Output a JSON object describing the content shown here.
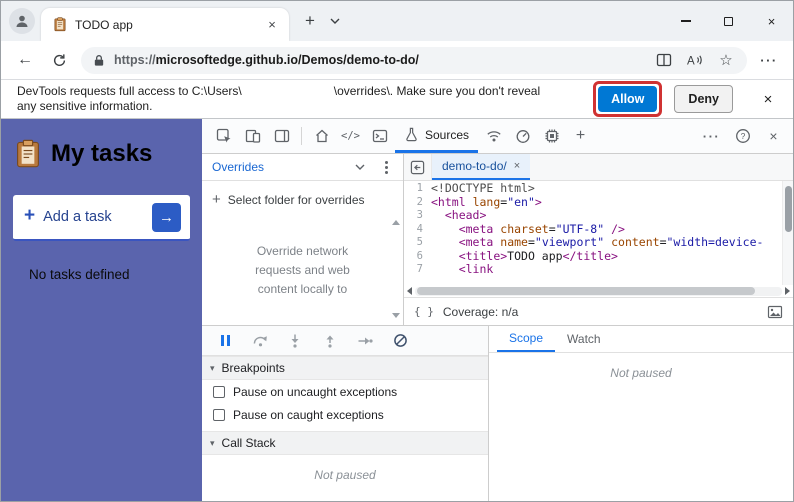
{
  "colors": {
    "app_bg": "#5a64ad",
    "accent": "#1a73e8",
    "allow_bg": "#0078d4",
    "annotation": "#d03232"
  },
  "icons": {
    "close": "×",
    "plus": "+",
    "back": "←",
    "star": "☆",
    "more": "···",
    "elements": "</>",
    "braces": "{ }",
    "arrow_right": "→",
    "disclosure": "▾"
  },
  "browser": {
    "tab_title": "TODO app",
    "url_scheme": "https://",
    "url_domain": "microsoftedge.github.io",
    "url_path": "/Demos/demo-to-do/"
  },
  "infobar": {
    "message_line1_before_redaction": "DevTools requests full access to C:\\Users\\",
    "message_line1_after_redaction": "\\overrides\\. Make sure you don't reveal",
    "message_line2": "any sensitive information.",
    "allow_label": "Allow",
    "deny_label": "Deny"
  },
  "app": {
    "title": "My tasks",
    "add_task_label": "Add a task",
    "empty_message": "No tasks defined"
  },
  "devtools": {
    "sources_tab_label": "Sources",
    "navigator": {
      "dropdown_label": "Overrides",
      "select_folder_label": "Select folder for overrides",
      "description_lines": [
        "Override network",
        "requests and web",
        "content locally to"
      ]
    },
    "editor": {
      "file_tab_label": "demo-to-do/",
      "coverage_label": "Coverage: n/a",
      "code_lines": [
        {
          "n": "1",
          "t": [
            [
              "meta",
              "<!DOCTYPE html>"
            ]
          ]
        },
        {
          "n": "2",
          "t": [
            [
              "tag",
              "<html"
            ],
            [
              "plain",
              " "
            ],
            [
              "attr",
              "lang"
            ],
            [
              "plain",
              "="
            ],
            [
              "str",
              "\"en\""
            ],
            [
              "tag",
              ">"
            ]
          ]
        },
        {
          "n": "3",
          "t": [
            [
              "plain",
              "  "
            ],
            [
              "tag",
              "<head>"
            ]
          ]
        },
        {
          "n": "4",
          "t": [
            [
              "plain",
              "    "
            ],
            [
              "tag",
              "<meta"
            ],
            [
              "plain",
              " "
            ],
            [
              "attr",
              "charset"
            ],
            [
              "plain",
              "="
            ],
            [
              "str",
              "\"UTF-8\""
            ],
            [
              "plain",
              " "
            ],
            [
              "tag",
              "/>"
            ]
          ]
        },
        {
          "n": "5",
          "t": [
            [
              "plain",
              "    "
            ],
            [
              "tag",
              "<meta"
            ],
            [
              "plain",
              " "
            ],
            [
              "attr",
              "name"
            ],
            [
              "plain",
              "="
            ],
            [
              "str",
              "\"viewport\""
            ],
            [
              "plain",
              " "
            ],
            [
              "attr",
              "content"
            ],
            [
              "plain",
              "="
            ],
            [
              "str",
              "\"width=device-"
            ]
          ]
        },
        {
          "n": "6",
          "t": [
            [
              "plain",
              "    "
            ],
            [
              "tag",
              "<title>"
            ],
            [
              "plain",
              "TODO app"
            ],
            [
              "tag",
              "</title>"
            ]
          ]
        },
        {
          "n": "7",
          "t": [
            [
              "plain",
              "    "
            ],
            [
              "tag",
              "<link"
            ]
          ]
        }
      ]
    },
    "debugger": {
      "breakpoints_label": "Breakpoints",
      "checkbox_labels": [
        "Pause on uncaught exceptions",
        "Pause on caught exceptions"
      ],
      "call_stack_label": "Call Stack",
      "not_paused_label": "Not paused",
      "scope_tab_label": "Scope",
      "watch_tab_label": "Watch"
    }
  }
}
